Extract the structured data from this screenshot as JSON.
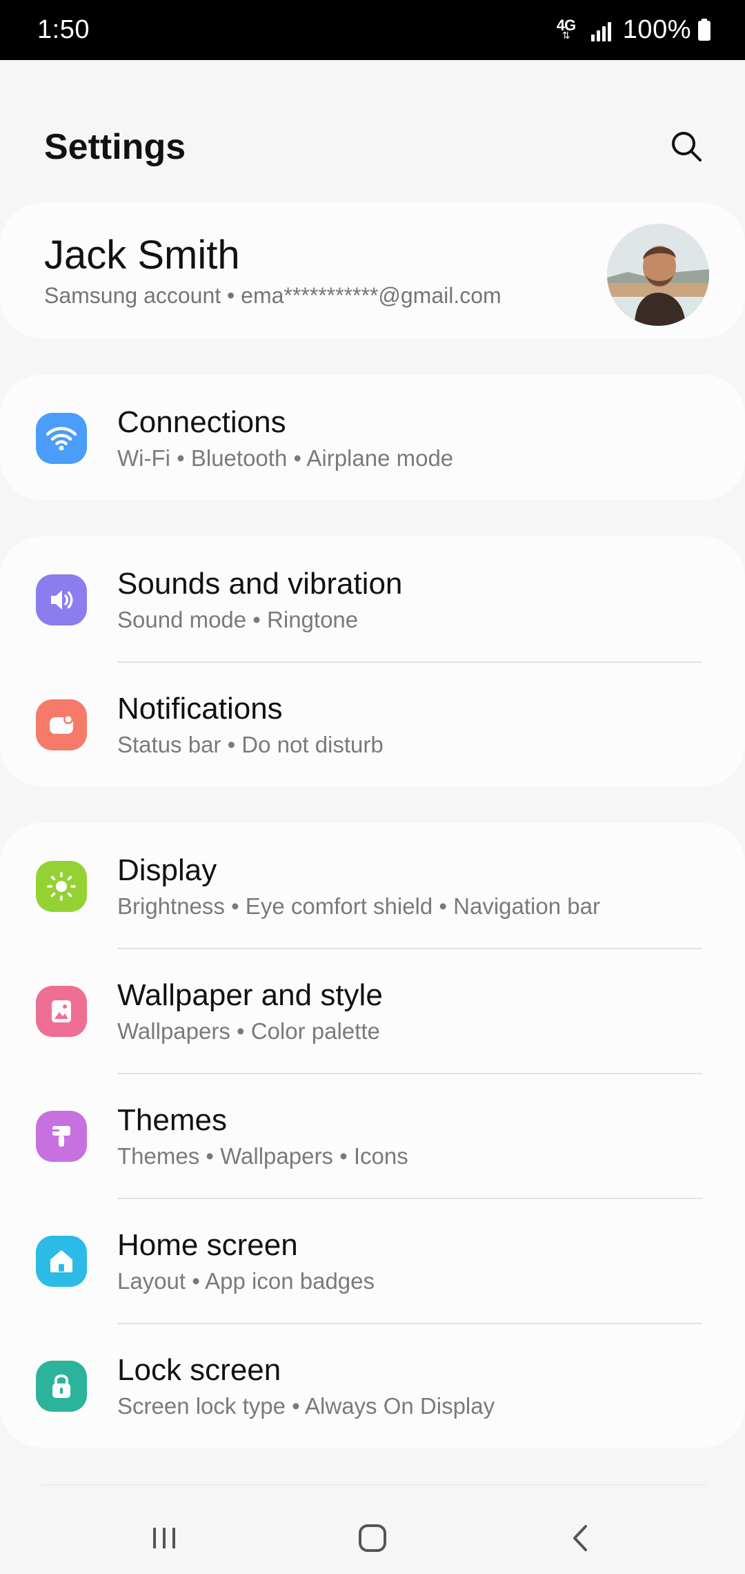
{
  "status_bar": {
    "time": "1:50",
    "network": "4G",
    "battery": "100%"
  },
  "header": {
    "title": "Settings"
  },
  "profile": {
    "name": "Jack Smith",
    "subtitle": "Samsung account  •  ema***********@gmail.com"
  },
  "groups": [
    {
      "items": [
        {
          "title": "Connections",
          "subtitle": "Wi-Fi  •  Bluetooth  •  Airplane mode",
          "icon": "wifi-icon",
          "color": "#4a9df8"
        }
      ]
    },
    {
      "items": [
        {
          "title": "Sounds and vibration",
          "subtitle": "Sound mode  •  Ringtone",
          "icon": "volume-icon",
          "color": "#8b7cf0"
        },
        {
          "title": "Notifications",
          "subtitle": "Status bar  •  Do not disturb",
          "icon": "notification-icon",
          "color": "#f57a6a"
        }
      ]
    },
    {
      "items": [
        {
          "title": "Display",
          "subtitle": "Brightness  •  Eye comfort shield  •  Navigation bar",
          "icon": "brightness-icon",
          "color": "#94d234"
        },
        {
          "title": "Wallpaper and style",
          "subtitle": "Wallpapers  •  Color palette",
          "icon": "wallpaper-icon",
          "color": "#ef6e93"
        },
        {
          "title": "Themes",
          "subtitle": "Themes  •  Wallpapers  •  Icons",
          "icon": "brush-icon",
          "color": "#c770e0"
        },
        {
          "title": "Home screen",
          "subtitle": "Layout  •  App icon badges",
          "icon": "home-icon",
          "color": "#2bbbe6"
        },
        {
          "title": "Lock screen",
          "subtitle": "Screen lock type  •  Always On Display",
          "icon": "lock-icon",
          "color": "#2bb39b"
        }
      ]
    }
  ],
  "nav_bar": {
    "items": [
      "recent-apps-icon",
      "home-nav-icon",
      "back-icon"
    ]
  }
}
